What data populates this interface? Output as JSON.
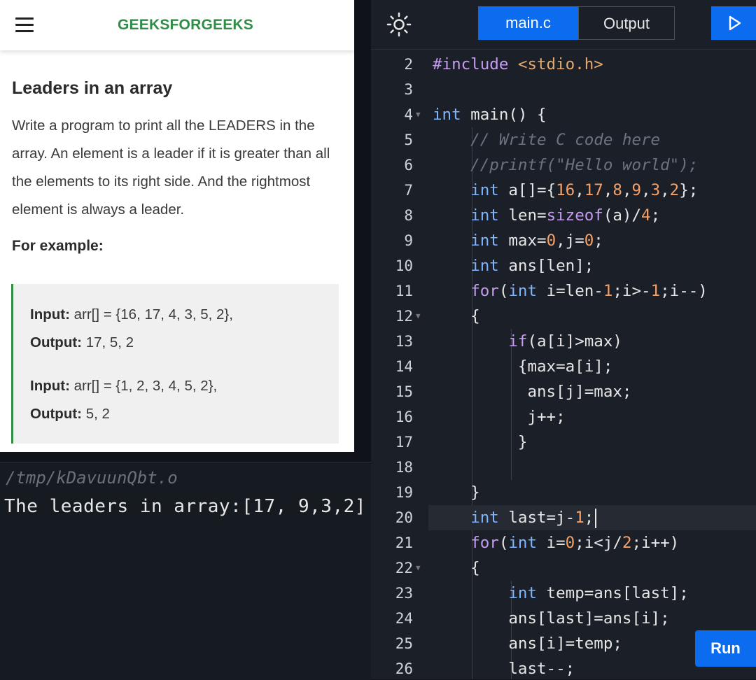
{
  "article": {
    "brand": "GEEKSFORGEEKS",
    "title": "Leaders in an array",
    "description": "Write a program to print all the LEADERS in the array. An element is a leader if it is greater than all the elements to its right side. And the rightmost element is always a leader.",
    "example_heading": "For example:",
    "examples": [
      {
        "input_label": "Input:",
        "input_value": " arr[] = {16, 17, 4, 3, 5, 2},",
        "output_label": "Output:",
        "output_value": " 17, 5, 2"
      },
      {
        "input_label": "Input:",
        "input_value": " arr[] = {1, 2, 3, 4, 5, 2},",
        "output_label": "Output:",
        "output_value": " 5, 2"
      }
    ]
  },
  "terminal": {
    "path": "/tmp/kDavuunQbt.o",
    "output": "The leaders in array:[17, 9,3,2]"
  },
  "editor": {
    "tabs": [
      {
        "label": "main.c",
        "active": true
      },
      {
        "label": "Output",
        "active": false
      }
    ],
    "line_numbers": [
      "2",
      "3",
      "4",
      "5",
      "6",
      "7",
      "8",
      "9",
      "10",
      "11",
      "12",
      "13",
      "14",
      "15",
      "16",
      "17",
      "18",
      "19",
      "20",
      "21",
      "22",
      "23",
      "24",
      "25",
      "26"
    ],
    "current_line": "20",
    "run_label": "Run"
  },
  "icons": {
    "menu": "hamburger-menu-icon",
    "theme": "sun-icon",
    "run": "play-icon"
  },
  "colors": {
    "brand_green": "#2f8d46",
    "accent_blue": "#0b6cf0",
    "editor_bg": "#1b1f27",
    "keyword": "#7fb5ff",
    "number": "#f4a067"
  }
}
